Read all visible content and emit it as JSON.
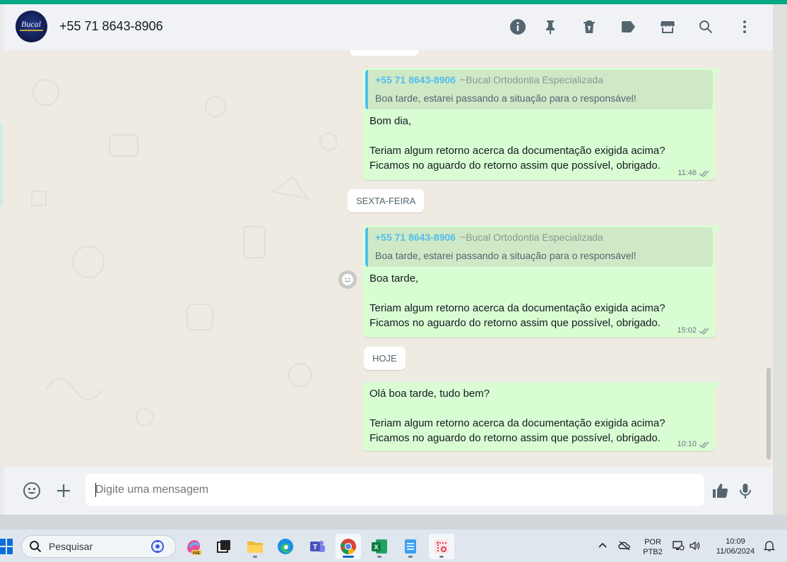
{
  "header": {
    "contact_name": "+55 71 8643-8906",
    "avatar_text": "Bucal",
    "icons": [
      "info-icon",
      "pin-icon",
      "delete-icon",
      "label-icon",
      "store-icon",
      "search-icon",
      "menu-icon"
    ]
  },
  "messages": [
    {
      "quote_author": "+55 71 8643-8906",
      "quote_group": "~Bucal Ortodontia Especializada",
      "quote_text": "Boa tarde, estarei passando a situação para o responsável!",
      "text": "Bom dia,\n\nTeriam algum retorno acerca da documentação exigida acima?\nFicamos no aguardo do retorno assim que possível, obrigado.",
      "time": "11:46"
    },
    {
      "quote_author": "+55 71 8643-8906",
      "quote_group": "~Bucal Ortodontia Especializada",
      "quote_text": "Boa tarde, estarei passando a situação para o responsável!",
      "text": "Boa tarde,\n\nTeriam algum retorno acerca da documentação exigida acima?\nFicamos no aguardo do retorno assim que possível, obrigado.",
      "time": "15:02"
    },
    {
      "text": "Olá boa tarde, tudo bem?\n\nTeriam algum retorno acerca da documentação exigida acima?\nFicamos no aguardo do retorno assim que possível, obrigado.",
      "time": "10:10"
    }
  ],
  "day_chips": [
    "SEXTA-FEIRA",
    "HOJE"
  ],
  "composer": {
    "placeholder": "Digite uma mensagem"
  },
  "taskbar": {
    "search_label": "Pesquisar",
    "language": "POR",
    "layout": "PTB2",
    "time": "10:09",
    "date": "11/06/2024"
  },
  "colors": {
    "accent": "#00a884",
    "outgoing_bubble": "#d9fdd3",
    "quote_author": "#53bdeb",
    "chat_bg": "#efeae2"
  }
}
